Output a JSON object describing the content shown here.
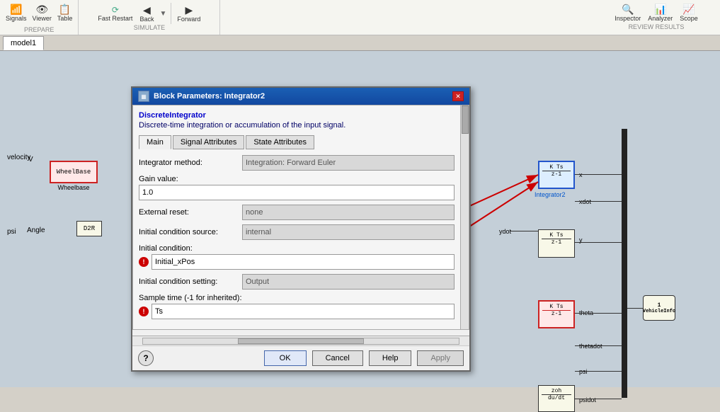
{
  "toolbar": {
    "sections": [
      {
        "name": "prepare",
        "label": "PREPARE",
        "buttons": [
          "Signals",
          "Viewer",
          "Table"
        ]
      },
      {
        "name": "simulate",
        "label": "SIMULATE",
        "buttons": [
          "Fast Restart",
          "Back",
          "Forward"
        ]
      },
      {
        "name": "review_results",
        "label": "REVIEW RESULTS",
        "buttons": [
          "Inspector",
          "Analyzer",
          "Scope"
        ]
      }
    ]
  },
  "tab": {
    "name": "model1",
    "label": "model1"
  },
  "dialog": {
    "title": "Block Parameters: Integrator2",
    "close_btn": "✕",
    "block_type": "DiscreteIntegrator",
    "description": "Discrete-time integration or accumulation of the input signal.",
    "tabs": [
      "Main",
      "Signal Attributes",
      "State Attributes"
    ],
    "active_tab": "Main",
    "fields": {
      "integrator_method_label": "Integrator method:",
      "integrator_method_value": "Integration: Forward Euler",
      "gain_value_label": "Gain value:",
      "gain_value": "1.0",
      "external_reset_label": "External reset:",
      "external_reset_value": "none",
      "initial_condition_source_label": "Initial condition source:",
      "initial_condition_source_value": "internal",
      "initial_condition_label": "Initial condition:",
      "initial_condition_value": "Initial_xPos",
      "initial_condition_setting_label": "Initial condition setting:",
      "initial_condition_setting_value": "Output",
      "sample_time_label": "Sample time (-1 for inherited):",
      "sample_time_value": "Ts"
    },
    "buttons": {
      "ok": "OK",
      "cancel": "Cancel",
      "help": "Help",
      "apply": "Apply",
      "help_icon": "?"
    }
  },
  "diagram": {
    "blocks": [
      {
        "id": "wheelbase",
        "label": "WheelBase",
        "sub": "Wheelbase",
        "type": "red"
      },
      {
        "id": "d2r",
        "label": "D2R"
      },
      {
        "id": "integrator2",
        "label": "K Ts\nz-1",
        "name": "Integrator2",
        "type": "blue"
      },
      {
        "id": "integrator_y",
        "label": "K Ts\nz-1",
        "type": "normal"
      },
      {
        "id": "integrator_theta",
        "label": "K Ts\nz-1",
        "type": "red"
      },
      {
        "id": "zoh",
        "label": "zoh\ndu/dt",
        "type": "normal"
      }
    ],
    "ports": [
      "x",
      "xdot",
      "y",
      "ydot",
      "theta",
      "thetadot",
      "psi",
      "psidot"
    ],
    "signals": [
      "V",
      "velocity",
      "psi",
      "Angle"
    ],
    "vehicleinfo": "1\nVehicleInfo"
  }
}
